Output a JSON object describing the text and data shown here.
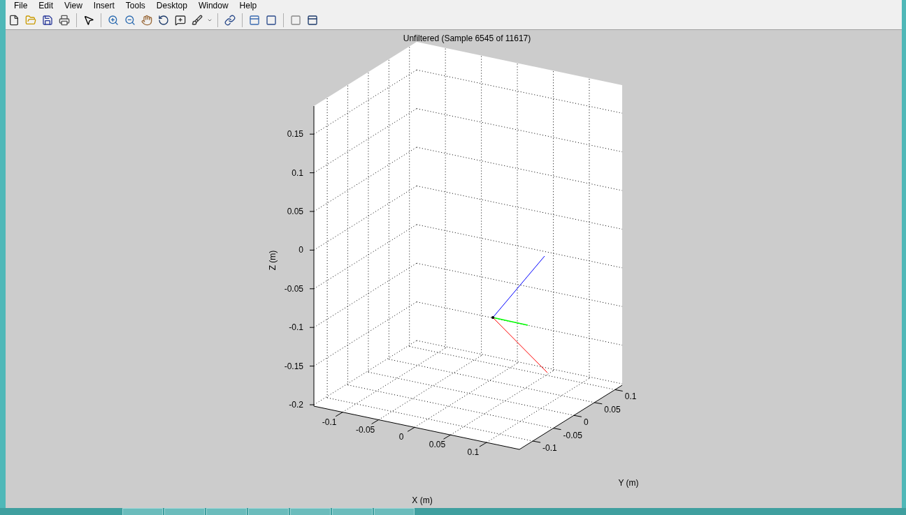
{
  "menu": [
    {
      "label": "File"
    },
    {
      "label": "Edit"
    },
    {
      "label": "View"
    },
    {
      "label": "Insert"
    },
    {
      "label": "Tools"
    },
    {
      "label": "Desktop"
    },
    {
      "label": "Window"
    },
    {
      "label": "Help"
    }
  ],
  "plot": {
    "title": "Unfiltered (Sample 6545 of 11617)",
    "xlabel": "X (m)",
    "ylabel": "Y (m)",
    "zlabel": "Z (m)",
    "xticks": [
      "-0.1",
      "-0.05",
      "0",
      "0.05",
      "0.1"
    ],
    "yticks": [
      "-0.1",
      "-0.05",
      "0",
      "0.05",
      "0.1"
    ],
    "zticks": [
      "0.15",
      "0.1",
      "0.05",
      "0",
      "-0.05",
      "-0.1",
      "-0.15",
      "-0.2"
    ]
  }
}
